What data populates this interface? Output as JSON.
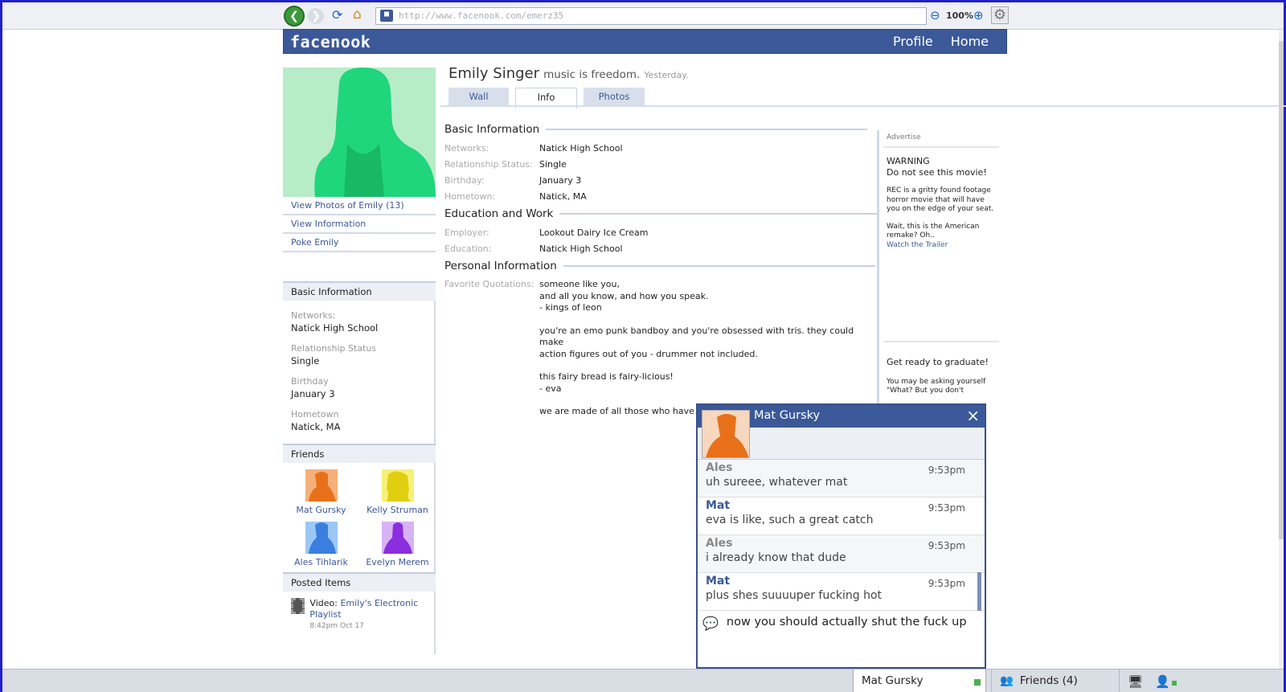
{
  "browser": {
    "url": "http://www.facenook.com/emerz35",
    "zoom": "100%"
  },
  "site": {
    "logo": "facenook",
    "nav": [
      "Profile",
      "Home"
    ]
  },
  "profile": {
    "name": "Emily Singer",
    "status": "music is freedom.",
    "timestamp": "Yesterday.",
    "tabs": [
      "Wall",
      "Info",
      "Photos"
    ],
    "active_tab": "Info"
  },
  "left": {
    "links": [
      "View Photos of Emily (13)",
      "View Information",
      "Poke Emily"
    ],
    "basic_title": "Basic Information",
    "basic": [
      {
        "label": "Networks:",
        "value": "Natick High School"
      },
      {
        "label": "Relationship Status",
        "value": "Single"
      },
      {
        "label": "Birthday",
        "value": "January 3"
      },
      {
        "label": "Hometown",
        "value": "Natick, MA"
      }
    ],
    "friends_title": "Friends",
    "friends": [
      "Mat Gursky",
      "Kelly Struman",
      "Ales Tihlarik",
      "Evelyn Merem"
    ],
    "posted_title": "Posted Items",
    "posted": {
      "prefix": "Video:",
      "link": "Emily's Electronic Playlist",
      "time": "8:42pm Oct 17"
    }
  },
  "info": {
    "basic_title": "Basic Information",
    "basic": [
      {
        "label": "Networks:",
        "value": "Natick High School"
      },
      {
        "label": "Relationship Status:",
        "value": "Single"
      },
      {
        "label": "Birthday:",
        "value": "January 3"
      },
      {
        "label": "Hometown:",
        "value": "Natick, MA"
      }
    ],
    "edu_title": "Education and Work",
    "edu": [
      {
        "label": "Employer:",
        "value": "Lookout Dairy Ice Cream"
      },
      {
        "label": "Education:",
        "value": "Natick High School"
      }
    ],
    "personal_title": "Personal Information",
    "quote_label": "Favorite Quotations:",
    "quotes": [
      "someone like you,",
      "and all you know, and how you speak.",
      "- kings of leon",
      "",
      "you're an emo punk bandboy and you're obsessed with tris. they could make",
      "action figures out of you - drummer not included.",
      "",
      "this fairy bread is fairy-licious!",
      "- eva",
      "",
      "we are made of all those who have built and broken us."
    ]
  },
  "ads": {
    "header": "Advertise",
    "ad1_title_1": "WARNING",
    "ad1_title_2": "Do not see this movie!",
    "ad1_text": "REC is a gritty found footage horror movie that will have you on the edge of your seat.",
    "ad1_text2": "Wait, this is the American remake? Oh..",
    "ad1_link": "Watch the Trailer",
    "ad2_title": "Get ready to graduate!",
    "ad2_text": "You may be asking yourself \"What? But you don't"
  },
  "chat": {
    "name": "Mat Gursky",
    "messages": [
      {
        "sender": "Ales",
        "time": "9:53pm",
        "text": "uh sureee, whatever mat"
      },
      {
        "sender": "Mat",
        "time": "9:53pm",
        "text": "eva is like, such a great catch"
      },
      {
        "sender": "Ales",
        "time": "9:53pm",
        "text": "i already know that dude"
      },
      {
        "sender": "Mat",
        "time": "9:53pm",
        "text": "plus shes suuuuper fucking hot"
      }
    ],
    "input": "now you should actually shut the fuck up"
  },
  "bottom": {
    "chat_tab": "Mat Gursky",
    "friends": "Friends (4)"
  },
  "colors": {
    "brand": "#3b5998",
    "online": "#4caf50"
  }
}
